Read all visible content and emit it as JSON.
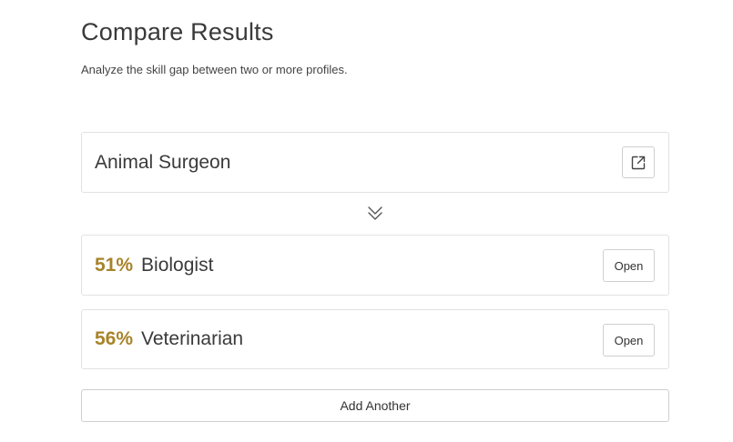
{
  "header": {
    "title": "Compare Results",
    "subtitle": "Analyze the skill gap between two or more profiles."
  },
  "source_profile": {
    "name": "Animal Surgeon",
    "action_icon": "external-link-icon"
  },
  "divider_icon": "double-chevron-down-icon",
  "results": [
    {
      "percent": "51%",
      "name": "Biologist",
      "action_label": "Open"
    },
    {
      "percent": "56%",
      "name": "Veterinarian",
      "action_label": "Open"
    }
  ],
  "add_button_label": "Add Another",
  "colors": {
    "percent_accent": "#a8832a",
    "border": "#e2e2e2",
    "text": "#3a3a3a"
  }
}
